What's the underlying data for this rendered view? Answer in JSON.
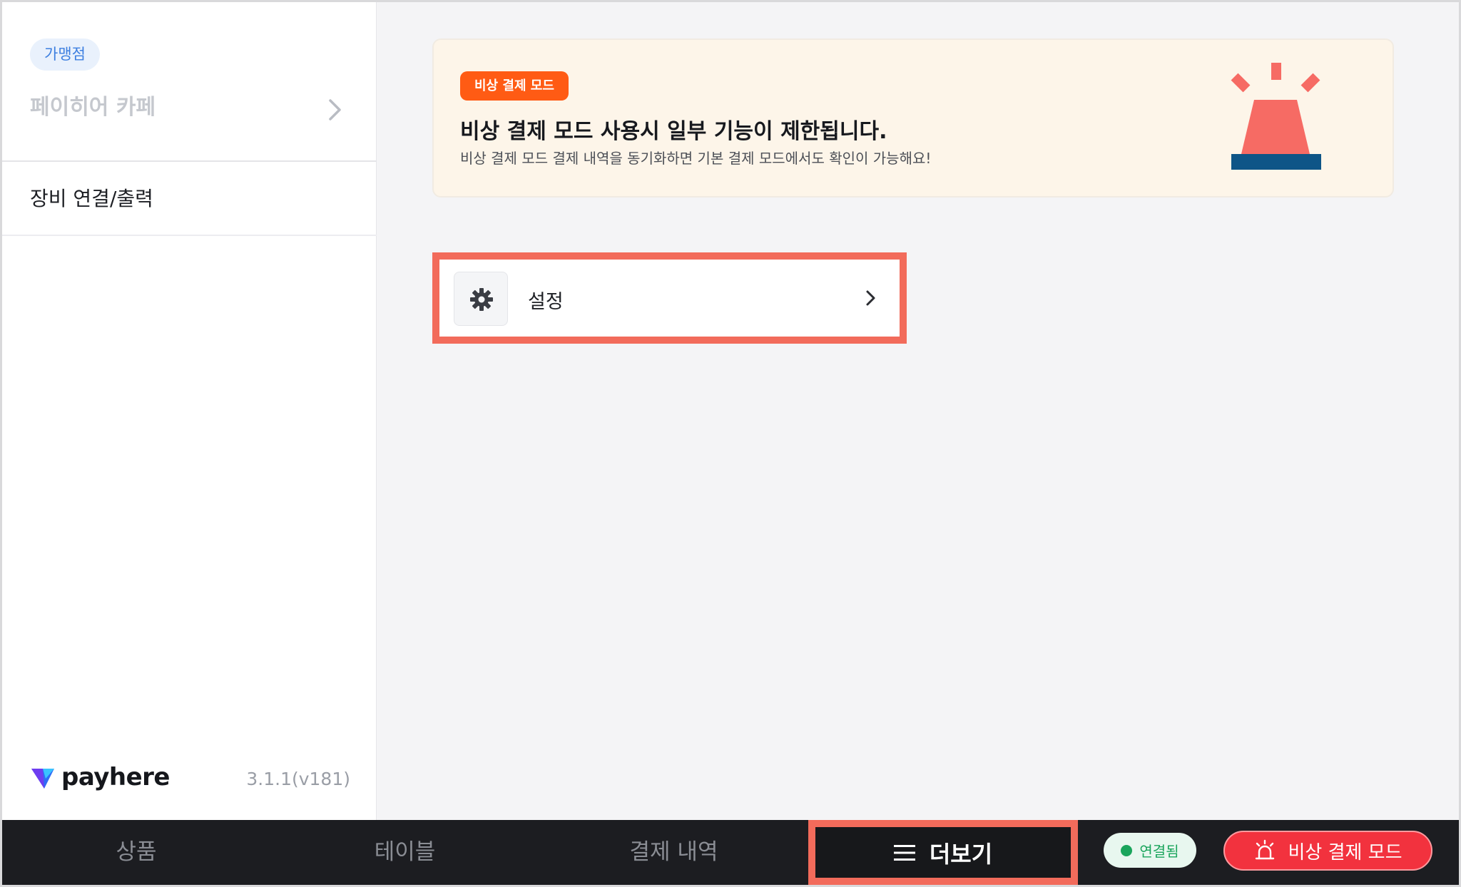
{
  "sidebar": {
    "store_badge": "가맹점",
    "store_name": "페이히어 카페",
    "menu_items": [
      {
        "label": "장비 연결/출력"
      }
    ],
    "brand": "payhere",
    "version": "3.1.1(v181)"
  },
  "banner": {
    "badge": "비상 결제 모드",
    "title": "비상 결제 모드 사용시 일부 기능이 제한됩니다.",
    "description": "비상 결제 모드 결제 내역을 동기화하면 기본 결제 모드에서도 확인이 가능해요!",
    "icon": "siren-icon"
  },
  "settings": {
    "label": "설정",
    "icon": "gear-icon"
  },
  "bottom_nav": {
    "tabs": [
      {
        "label": "상품"
      },
      {
        "label": "테이블"
      },
      {
        "label": "결제 내역"
      },
      {
        "label": "더보기",
        "icon": "menu-icon",
        "active": true
      }
    ],
    "status": "연결됨",
    "emergency_button": "비상 결제 모드"
  },
  "colors": {
    "accent_orange": "#ff5b14",
    "highlight": "#f26b5b",
    "emergency_red": "#f2323e",
    "connected_green": "#1aa55c"
  }
}
